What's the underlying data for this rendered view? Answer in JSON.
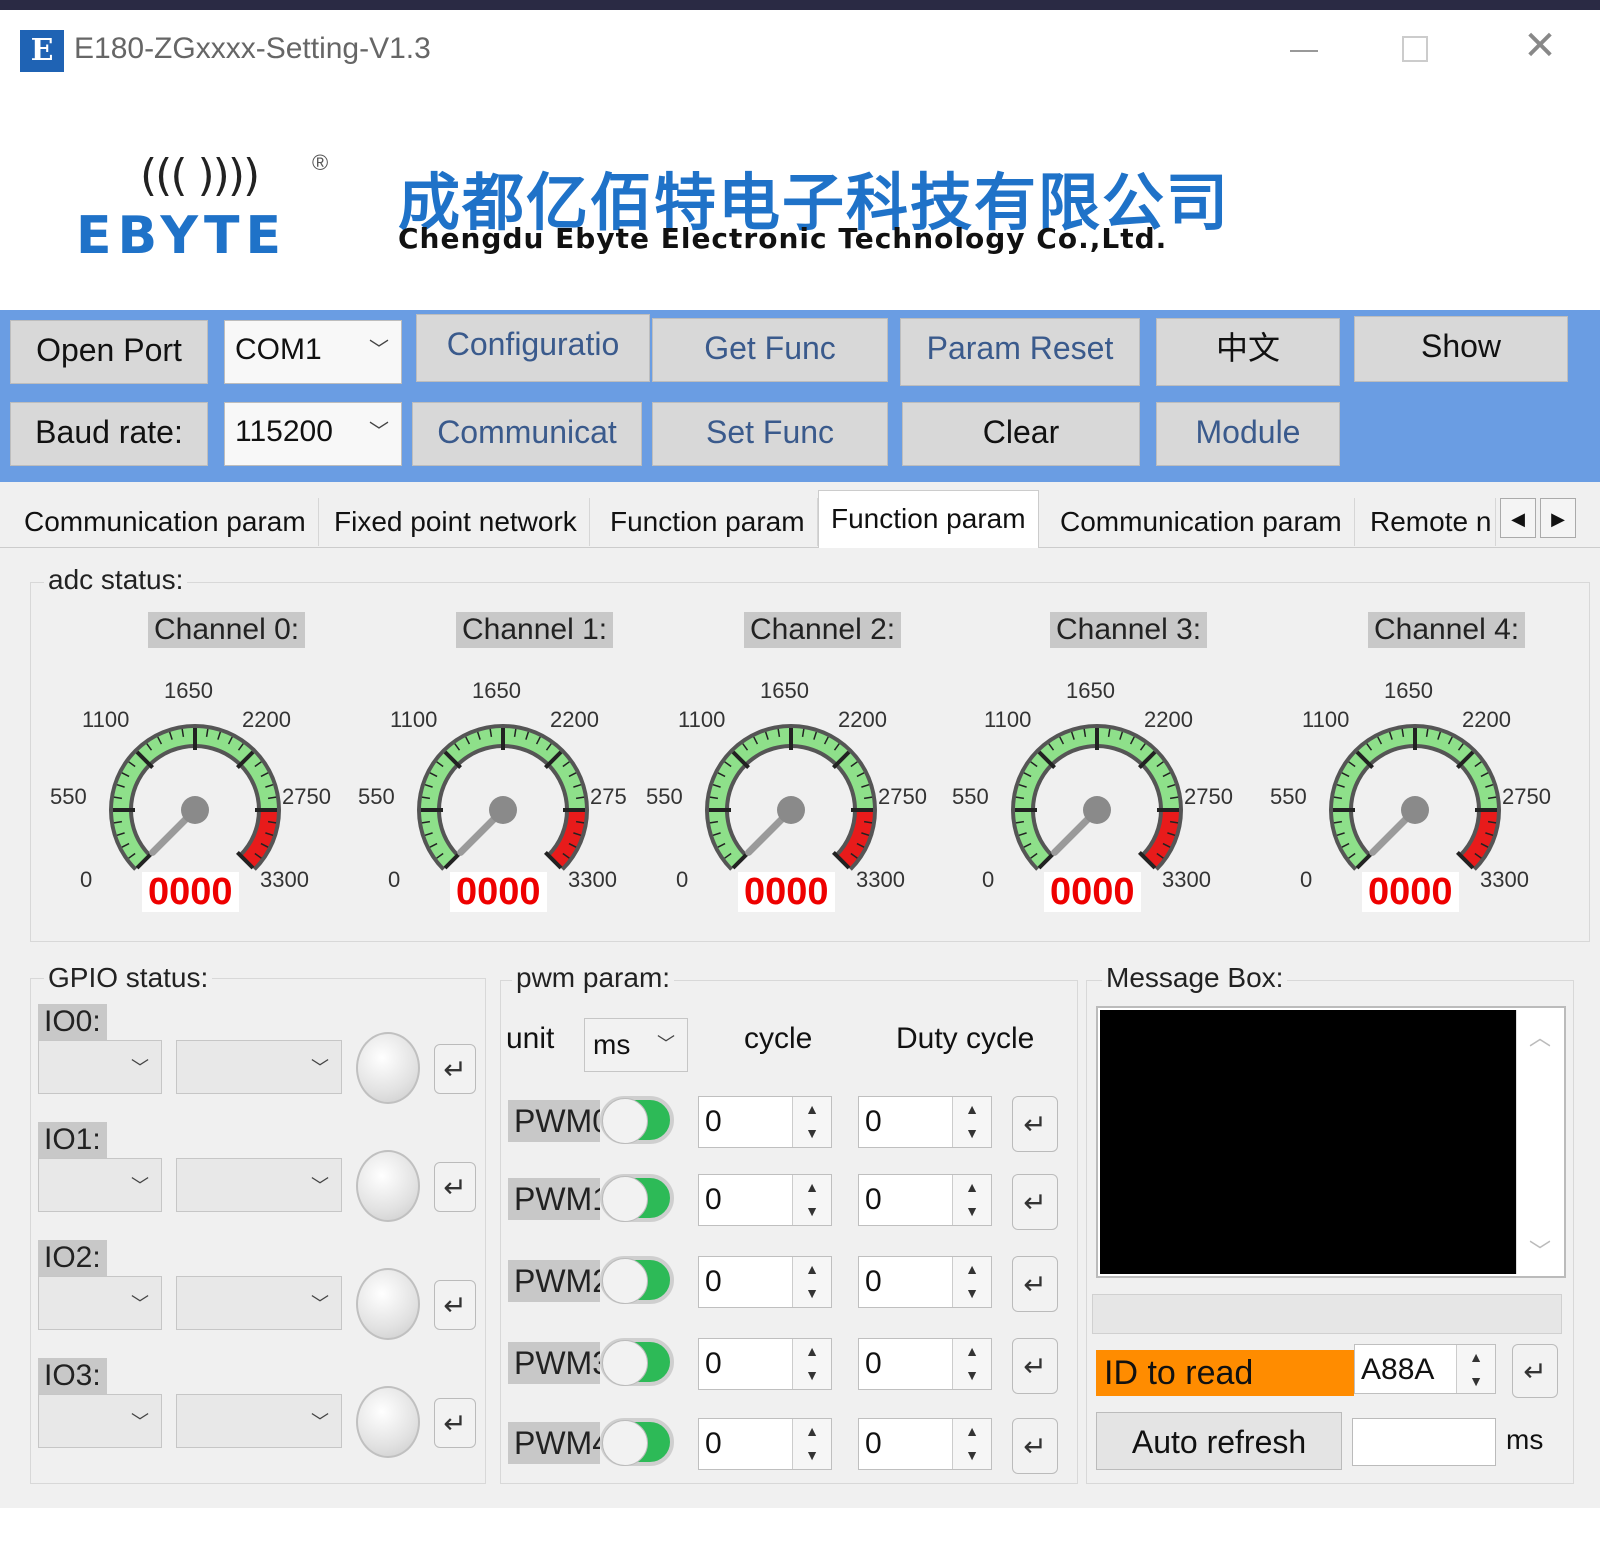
{
  "window": {
    "title": "E180-ZGxxxx-Setting-V1.3",
    "icon_letter": "E"
  },
  "banner": {
    "logo_waves": "((( ))))",
    "logo_reg": "®",
    "logo_text": "EBYTE",
    "company_cn": "成都亿佰特电子科技有限公司",
    "company_en": "Chengdu Ebyte Electronic Technology Co.,Ltd."
  },
  "toolbar": {
    "open_port": "Open Port",
    "com_value": "COM1",
    "configuration": "Configuratio",
    "get_func": "Get Func",
    "param_reset": "Param Reset",
    "language": "中文",
    "show": "Show",
    "baud_label": "Baud rate:",
    "baud_value": "115200",
    "communication": "Communicat",
    "set_func": "Set Func",
    "clear": "Clear",
    "module": "Module"
  },
  "tabs": [
    "Communication param",
    "Fixed point network",
    "Function param",
    "Function param",
    "Communication param",
    "Remote n"
  ],
  "active_tab": 3,
  "adc": {
    "label": "adc status:",
    "ticks": [
      "0",
      "550",
      "1100",
      "1650",
      "2200",
      "2750",
      "3300"
    ],
    "channels": [
      {
        "name": "Channel 0:",
        "value": "0000",
        "tick_2750": "2750"
      },
      {
        "name": "Channel 1:",
        "value": "0000",
        "tick_2750": "275"
      },
      {
        "name": "Channel 2:",
        "value": "0000",
        "tick_2750": "2750"
      },
      {
        "name": "Channel 3:",
        "value": "0000",
        "tick_2750": "2750"
      },
      {
        "name": "Channel 4:",
        "value": "0000",
        "tick_2750": "2750"
      }
    ],
    "gauge_max": 3300,
    "warning_start": 2750
  },
  "gpio": {
    "label": "GPIO status:",
    "pins": [
      {
        "name": "IO0:"
      },
      {
        "name": "IO1:"
      },
      {
        "name": "IO2:"
      },
      {
        "name": "IO3:"
      }
    ]
  },
  "pwm": {
    "label": "pwm param:",
    "unit_label": "unit",
    "unit_value": "ms",
    "cycle_header": "cycle",
    "duty_header": "Duty cycle",
    "channels": [
      {
        "name": "PWM0",
        "cycle": "0",
        "duty": "0"
      },
      {
        "name": "PWM1",
        "cycle": "0",
        "duty": "0"
      },
      {
        "name": "PWM2",
        "cycle": "0",
        "duty": "0"
      },
      {
        "name": "PWM3",
        "cycle": "0",
        "duty": "0"
      },
      {
        "name": "PWM4",
        "cycle": "0",
        "duty": "0"
      }
    ]
  },
  "message": {
    "label": "Message Box:",
    "id_label": "ID to read",
    "id_value": "A88A",
    "auto_refresh": "Auto refresh",
    "refresh_value": "",
    "ms_label": "ms"
  },
  "colors": {
    "toolbar_bg": "#6a9de3",
    "brand_blue": "#1f72c8",
    "gauge_value": "#ee0000",
    "id_highlight": "#ff8c00",
    "toggle_on": "#2dba57"
  }
}
